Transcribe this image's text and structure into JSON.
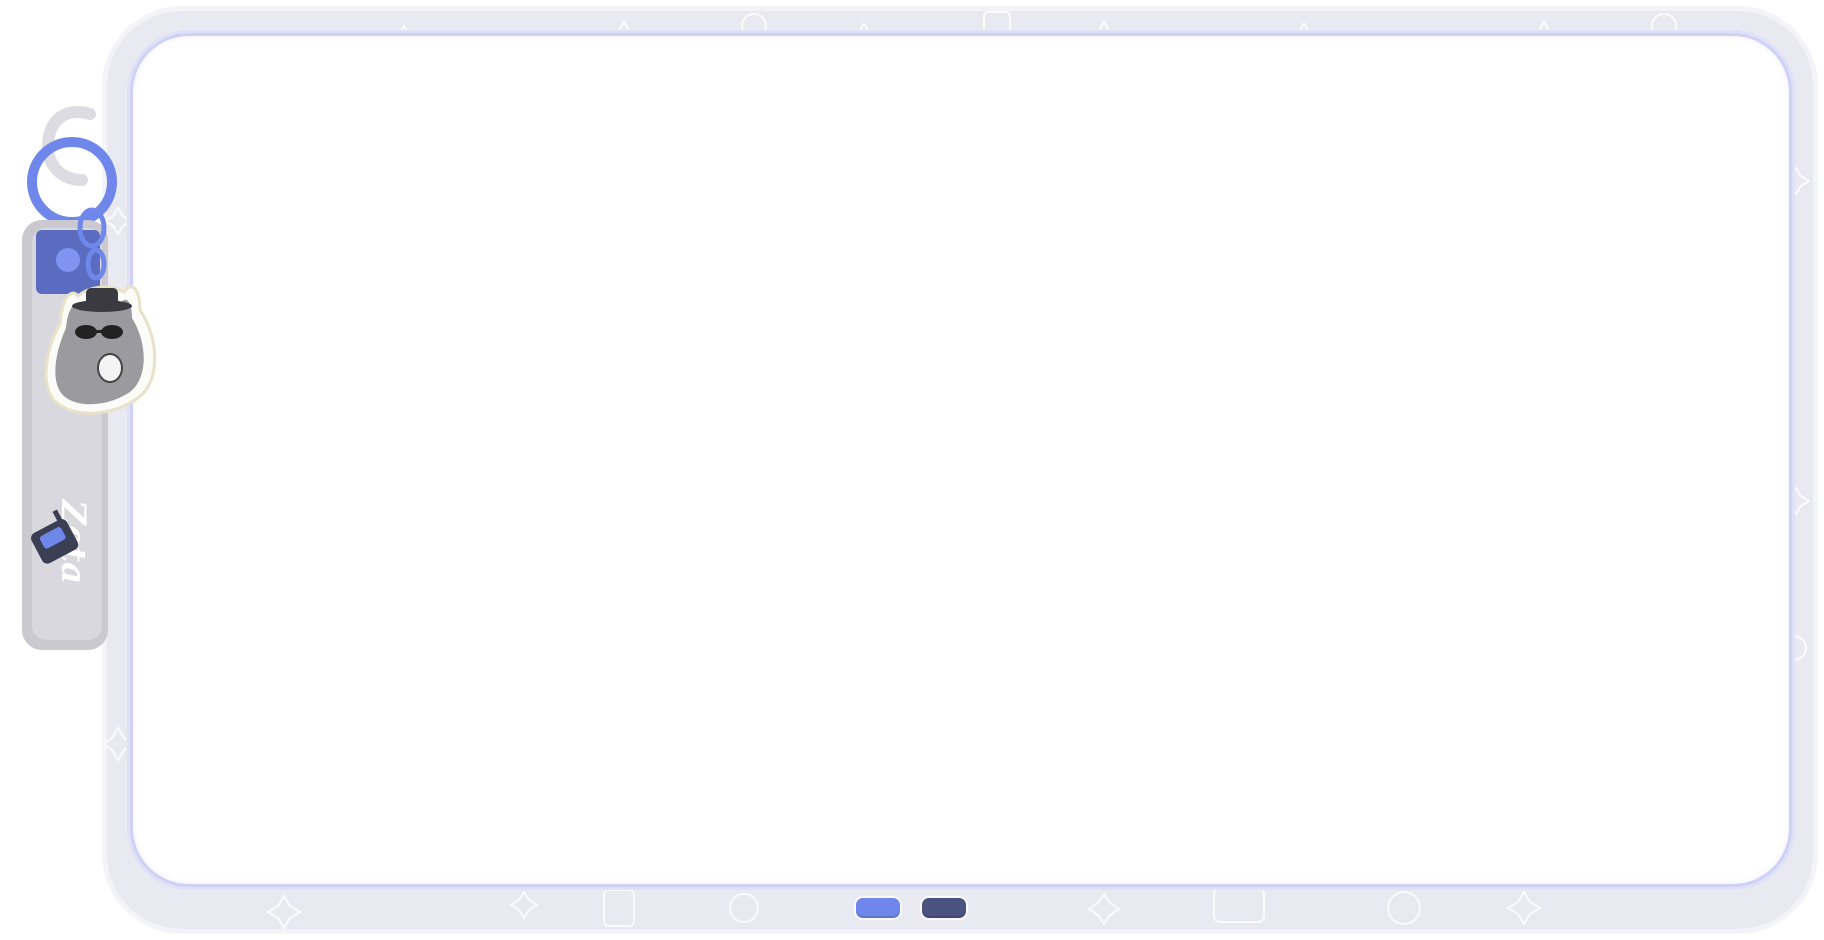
{
  "charm": {
    "strap_text": "Zeta",
    "icon": "cat-keychain-icon",
    "device_icon": "walkie-talkie-icon"
  },
  "pager": {
    "dots": [
      {
        "color": "#6f86ea",
        "active": true
      },
      {
        "color": "#4a5380",
        "active": false
      }
    ]
  },
  "colors": {
    "frame": "#e9e9f1",
    "accent": "#7086ec",
    "screen": "#ffffff"
  }
}
